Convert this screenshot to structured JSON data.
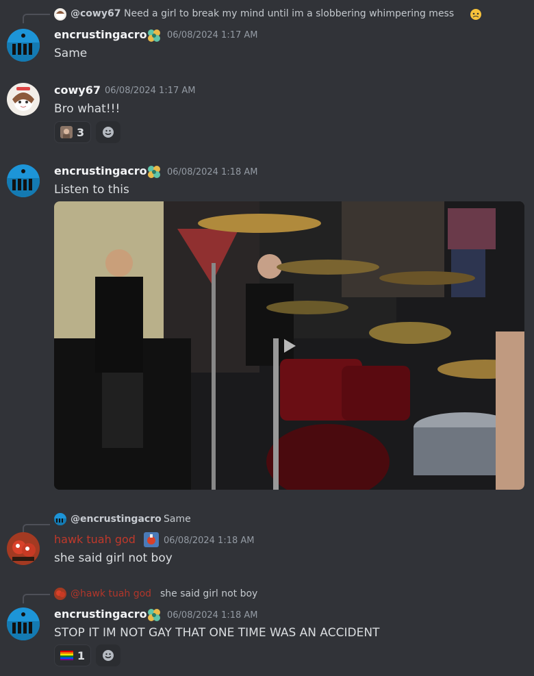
{
  "messages": [
    {
      "reply": {
        "user": "@cowy67",
        "text": "Need a girl to break my mind until im a slobbering whimpering mess",
        "emoji": "face-holding-back-tears-emoji"
      },
      "author": "encrustingacro",
      "timestamp": "06/08/2024 1:17 AM",
      "text": "Same",
      "badge": "clover-badge-icon"
    },
    {
      "author": "cowy67",
      "timestamp": "06/08/2024 1:17 AM",
      "text": "Bro what!!!",
      "reaction": {
        "emoji": "face-custom-emoji",
        "count": "3"
      }
    },
    {
      "author": "encrustingacro",
      "timestamp": "06/08/2024 1:18 AM",
      "text": "Listen to this",
      "badge": "clover-badge-icon",
      "attachment": "video"
    },
    {
      "reply": {
        "user": "@encrustingacro",
        "text": "Same"
      },
      "author": "hawk tuah god",
      "timestamp": "06/08/2024 1:18 AM",
      "text": "she said girl not boy",
      "author_color": "#c0392b"
    },
    {
      "reply": {
        "user": "@hawk tuah god",
        "text": "she said girl not boy"
      },
      "author": "encrustingacro",
      "timestamp": "06/08/2024 1:18 AM",
      "text": "STOP IT IM NOT GAY THAT ONE TIME WAS AN ACCIDENT",
      "badge": "clover-badge-icon",
      "reaction": {
        "emoji": "rainbow-flag-emoji",
        "count": "1"
      }
    }
  ],
  "colors": {
    "background": "#313338",
    "text": "#dbdee1",
    "muted": "#949ba4",
    "accent_red": "#c0392b"
  }
}
